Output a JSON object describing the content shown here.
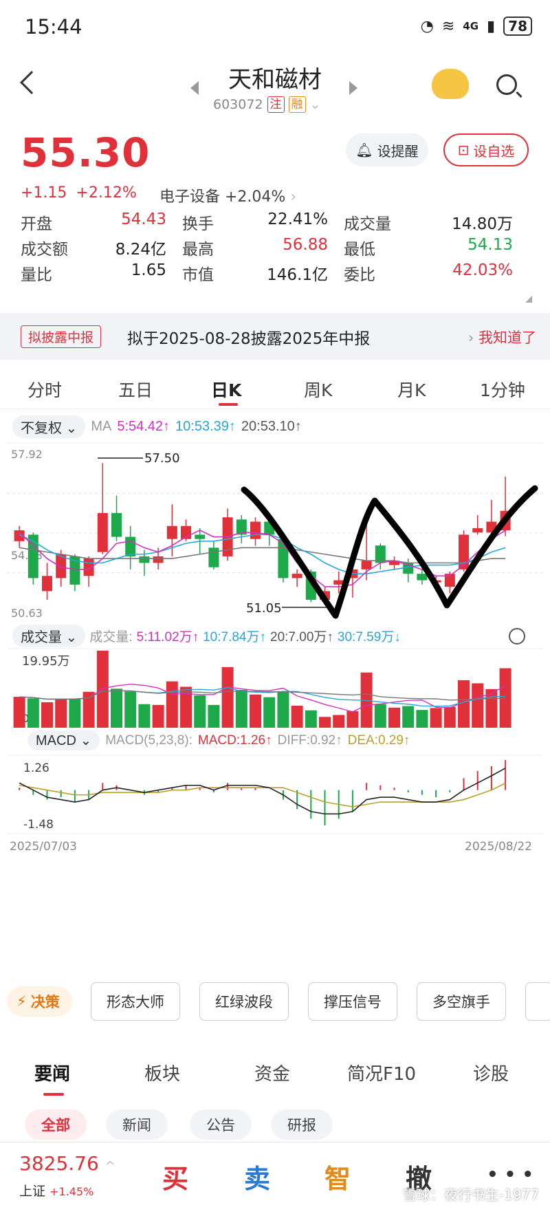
{
  "status_bar": {
    "time": "15:44",
    "network": "4G",
    "battery": "78"
  },
  "header": {
    "title": "天和磁材",
    "code": "603072",
    "tag1": "注",
    "tag2": "融"
  },
  "quote": {
    "price": "55.30",
    "change": "+1.15",
    "change_pct": "+2.12%",
    "sector": "电子设备 +2.04%",
    "alert_btn": "设提醒",
    "watch_btn": "设自选",
    "stats": [
      {
        "label": "开盘",
        "value": "54.43",
        "color": "red"
      },
      {
        "label": "换手",
        "value": "22.41%",
        "color": "neutral"
      },
      {
        "label": "成交量",
        "value": "14.80万",
        "color": "neutral"
      },
      {
        "label": "成交额",
        "value": "8.24亿",
        "color": "neutral"
      },
      {
        "label": "最高",
        "value": "56.88",
        "color": "red"
      },
      {
        "label": "最低",
        "value": "54.13",
        "color": "green"
      },
      {
        "label": "量比",
        "value": "1.65",
        "color": "neutral"
      },
      {
        "label": "市值",
        "value": "146.1亿",
        "color": "neutral"
      },
      {
        "label": "委比",
        "value": "42.03%",
        "color": "red"
      }
    ]
  },
  "notice": {
    "tag": "拟披露中报",
    "text": "拟于2025-08-28披露2025年中报",
    "action": "我知道了"
  },
  "tabs": [
    "分时",
    "五日",
    "日K",
    "周K",
    "月K",
    "1分钟"
  ],
  "active_tab": "日K",
  "ma_bar": {
    "adjust": "不复权",
    "label": "MA",
    "ma5": "5:54.42↑",
    "ma10": "10:53.39↑",
    "ma20": "20:53.10↑"
  },
  "vol_bar": {
    "label": "成交量",
    "prefix": "成交量:",
    "v5": "5:11.02万↑",
    "v10": "10:7.84万↑",
    "v20": "20:7.00万↑",
    "v30": "30:7.59万↓"
  },
  "macd_bar": {
    "label": "MACD",
    "params": "MACD(5,23,8):",
    "macd": "MACD:1.26↑",
    "diff": "DIFF:0.92↑",
    "dea": "DEA:0.29↑"
  },
  "chart_data": {
    "type": "candlestick",
    "price_axis": {
      "top": "57.92",
      "mid": "54.28",
      "bottom": "50.63"
    },
    "high_label": "57.50",
    "low_label": "51.05",
    "vol_axis": {
      "top": "19.95万",
      "bottom": "0"
    },
    "macd_axis": {
      "top": "1.26",
      "bottom": "-1.48"
    },
    "start_date": "2025/07/03",
    "end_date": "2025/08/22",
    "candles": [
      {
        "o": 53.9,
        "c": 54.4,
        "h": 54.6,
        "l": 53.6
      },
      {
        "o": 54.2,
        "c": 52.2,
        "h": 54.3,
        "l": 51.9
      },
      {
        "o": 51.6,
        "c": 52.3,
        "h": 52.9,
        "l": 51.2
      },
      {
        "o": 52.2,
        "c": 53.3,
        "h": 53.5,
        "l": 51.8
      },
      {
        "o": 53.2,
        "c": 51.9,
        "h": 53.3,
        "l": 51.6
      },
      {
        "o": 52.3,
        "c": 53.1,
        "h": 53.2,
        "l": 51.8
      },
      {
        "o": 53.4,
        "c": 55.2,
        "h": 57.5,
        "l": 53.3
      },
      {
        "o": 55.2,
        "c": 54.1,
        "h": 56.0,
        "l": 53.9
      },
      {
        "o": 54.1,
        "c": 53.2,
        "h": 54.6,
        "l": 52.6
      },
      {
        "o": 53.2,
        "c": 52.9,
        "h": 53.5,
        "l": 52.3
      },
      {
        "o": 52.9,
        "c": 53.2,
        "h": 53.6,
        "l": 52.6
      },
      {
        "o": 54.0,
        "c": 54.6,
        "h": 55.6,
        "l": 53.2
      },
      {
        "o": 54.0,
        "c": 54.6,
        "h": 54.9,
        "l": 53.9
      },
      {
        "o": 54.2,
        "c": 54.0,
        "h": 54.5,
        "l": 53.3
      },
      {
        "o": 53.6,
        "c": 52.7,
        "h": 53.9,
        "l": 52.6
      },
      {
        "o": 53.2,
        "c": 55.0,
        "h": 55.4,
        "l": 53.0
      },
      {
        "o": 54.9,
        "c": 54.2,
        "h": 55.1,
        "l": 53.8
      },
      {
        "o": 54.0,
        "c": 54.8,
        "h": 55.0,
        "l": 53.7
      },
      {
        "o": 54.8,
        "c": 54.2,
        "h": 54.8,
        "l": 53.7
      },
      {
        "o": 54.0,
        "c": 52.2,
        "h": 54.1,
        "l": 52.0
      },
      {
        "o": 52.2,
        "c": 52.4,
        "h": 52.6,
        "l": 51.8
      },
      {
        "o": 52.5,
        "c": 51.2,
        "h": 52.6,
        "l": 51.1
      },
      {
        "o": 51.2,
        "c": 51.6,
        "h": 51.8,
        "l": 51.05
      },
      {
        "o": 51.9,
        "c": 52.1,
        "h": 52.5,
        "l": 51.5
      },
      {
        "o": 52.2,
        "c": 52.6,
        "h": 53.4,
        "l": 51.3
      },
      {
        "o": 52.6,
        "c": 53.0,
        "h": 55.0,
        "l": 52.1
      },
      {
        "o": 53.7,
        "c": 52.9,
        "h": 53.8,
        "l": 52.6
      },
      {
        "o": 52.8,
        "c": 53.0,
        "h": 53.2,
        "l": 52.6
      },
      {
        "o": 52.9,
        "c": 52.4,
        "h": 53.1,
        "l": 52.0
      },
      {
        "o": 52.4,
        "c": 52.1,
        "h": 52.6,
        "l": 51.9
      },
      {
        "o": 52.0,
        "c": 52.1,
        "h": 52.3,
        "l": 51.6
      },
      {
        "o": 51.8,
        "c": 52.4,
        "h": 52.5,
        "l": 51.5
      },
      {
        "o": 52.6,
        "c": 54.2,
        "h": 54.4,
        "l": 52.5
      },
      {
        "o": 54.3,
        "c": 54.5,
        "h": 55.1,
        "l": 54.2
      },
      {
        "o": 54.3,
        "c": 54.8,
        "h": 55.8,
        "l": 53.9
      },
      {
        "o": 54.4,
        "c": 55.3,
        "h": 56.88,
        "l": 54.13
      }
    ],
    "volume": [
      8,
      7.6,
      6.6,
      7.4,
      7.5,
      9.3,
      19.95,
      10.1,
      9.4,
      6.1,
      5.9,
      12.0,
      10.6,
      8.4,
      5.9,
      15.7,
      9.8,
      8.6,
      7.9,
      9.2,
      5.7,
      4.5,
      2.8,
      3.3,
      4.3,
      14.3,
      6.1,
      5.2,
      5.6,
      4.6,
      5.1,
      5.4,
      12.3,
      11.5,
      10.0,
      15.4
    ],
    "ma_lines": {
      "ma5": [
        54.3,
        53.7,
        53.1,
        52.7,
        52.6,
        52.6,
        53.1,
        53.8,
        53.9,
        53.6,
        53.4,
        53.7,
        54.1,
        54.4,
        54.1,
        54.1,
        54.3,
        54.3,
        54.2,
        53.8,
        52.9,
        52.3,
        51.8,
        51.8,
        51.9,
        52.5,
        52.9,
        53.0,
        52.8,
        52.6,
        52.3,
        52.3,
        52.8,
        53.4,
        54.0,
        54.4
      ],
      "ma10": [
        54.2,
        53.9,
        53.5,
        53.2,
        53.0,
        52.9,
        52.9,
        53.1,
        53.3,
        53.3,
        53.4,
        53.6,
        53.8,
        53.9,
        53.9,
        54.0,
        54.1,
        54.2,
        54.2,
        54.0,
        53.6,
        53.3,
        52.9,
        52.6,
        52.4,
        52.4,
        52.5,
        52.6,
        52.7,
        52.8,
        52.8,
        52.8,
        52.9,
        53.1,
        53.4,
        53.6
      ],
      "ma20": [
        53.6,
        53.5,
        53.4,
        53.3,
        53.2,
        53.1,
        53.1,
        53.1,
        53.1,
        53.1,
        53.1,
        53.1,
        53.2,
        53.3,
        53.4,
        53.5,
        53.6,
        53.6,
        53.6,
        53.6,
        53.5,
        53.4,
        53.3,
        53.2,
        53.1,
        53.0,
        53.0,
        53.0,
        52.9,
        52.9,
        52.9,
        52.9,
        52.9,
        53.0,
        53.1,
        53.1
      ]
    },
    "macd_hist": [
      0.1,
      -0.2,
      -0.4,
      -0.3,
      -0.5,
      -0.4,
      0.3,
      0.2,
      0.0,
      -0.2,
      -0.1,
      0.1,
      0.2,
      0.1,
      -0.1,
      0.3,
      0.1,
      0.1,
      0.0,
      -0.4,
      -0.8,
      -1.2,
      -1.48,
      -1.2,
      -0.9,
      0.3,
      0.2,
      0.1,
      -0.1,
      -0.2,
      -0.3,
      -0.1,
      0.5,
      0.8,
      1.0,
      1.26
    ],
    "macd_diff": [
      0.3,
      0.0,
      -0.3,
      -0.4,
      -0.5,
      -0.4,
      0.0,
      0.1,
      0.0,
      -0.1,
      0.0,
      0.1,
      0.2,
      0.2,
      0.0,
      0.2,
      0.2,
      0.2,
      0.1,
      -0.2,
      -0.6,
      -0.9,
      -1.0,
      -1.0,
      -0.9,
      -0.4,
      -0.3,
      -0.3,
      -0.4,
      -0.5,
      -0.5,
      -0.4,
      0.0,
      0.3,
      0.6,
      0.92
    ],
    "macd_dea": [
      0.2,
      0.1,
      0.0,
      -0.1,
      -0.2,
      -0.2,
      -0.1,
      -0.1,
      -0.1,
      -0.1,
      -0.1,
      0.0,
      0.0,
      0.1,
      0.1,
      0.1,
      0.1,
      0.1,
      0.1,
      0.1,
      -0.1,
      -0.3,
      -0.5,
      -0.6,
      -0.7,
      -0.6,
      -0.5,
      -0.5,
      -0.5,
      -0.5,
      -0.5,
      -0.5,
      -0.4,
      -0.2,
      0.0,
      0.29
    ]
  },
  "strategy": {
    "label": "决策",
    "buttons": [
      "形态大师",
      "红绿波段",
      "撑压信号",
      "多空旗手"
    ]
  },
  "news_tabs": [
    "要闻",
    "板块",
    "资金",
    "简况F10",
    "诊股"
  ],
  "news_chips": [
    "全部",
    "新闻",
    "公告",
    "研报"
  ],
  "bottom_bar": {
    "index_value": "3825.76",
    "index_name": "上证",
    "index_change": "+1.45%",
    "buy": "买",
    "sell": "卖",
    "smart": "智",
    "cancel": "撤",
    "more": "• • •",
    "watermark": "雪球：夜行书生-1977"
  },
  "colors": {
    "up": "#e0303a",
    "down": "#1da94a",
    "ma5": "#d62fbe",
    "ma10": "#27a6d8",
    "ma20": "#777777",
    "dea": "#b8a12a"
  }
}
